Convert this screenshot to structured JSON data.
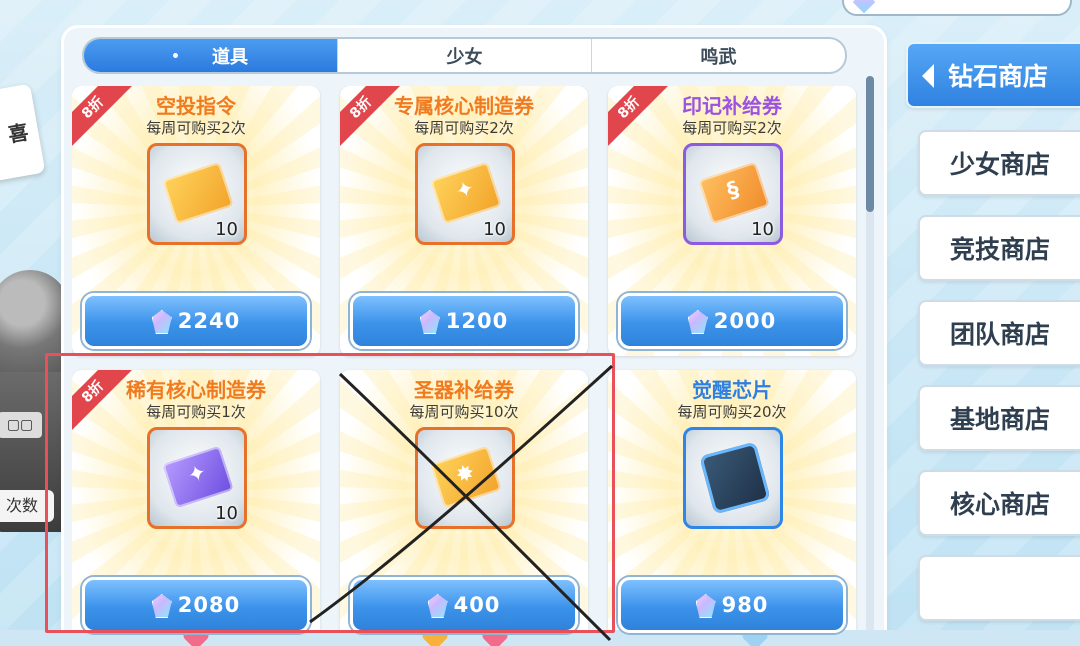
{
  "tabs": [
    {
      "label": "道具",
      "active": true
    },
    {
      "label": "少女",
      "active": false
    },
    {
      "label": "鸣武",
      "active": false
    }
  ],
  "left_overlay": {
    "badge_text": "喜",
    "times_label": "次数"
  },
  "items": [
    {
      "name": "空投指令",
      "limit": "每周可购买2次",
      "discount": "8折",
      "qty": "10",
      "price": "2240",
      "name_color": "#f07a1e"
    },
    {
      "name": "专属核心制造券",
      "limit": "每周可购买2次",
      "discount": "8折",
      "qty": "10",
      "price": "1200",
      "name_color": "#f07a1e"
    },
    {
      "name": "印记补给券",
      "limit": "每周可购买2次",
      "discount": "8折",
      "qty": "10",
      "price": "2000",
      "name_color": "#9a52e0"
    },
    {
      "name": "稀有核心制造券",
      "limit": "每周可购买1次",
      "discount": "8折",
      "qty": "10",
      "price": "2080",
      "name_color": "#f07a1e"
    },
    {
      "name": "圣器补给券",
      "limit": "每周可购买10次",
      "discount": "",
      "qty": "",
      "price": "400",
      "name_color": "#f07a1e"
    },
    {
      "name": "觉醒芯片",
      "limit": "每周可购买20次",
      "discount": "",
      "qty": "",
      "price": "980",
      "name_color": "#2d7fe0"
    }
  ],
  "sidebar": {
    "items": [
      {
        "label": "钻石商店",
        "active": true
      },
      {
        "label": "少女商店",
        "active": false
      },
      {
        "label": "竞技商店",
        "active": false
      },
      {
        "label": "团队商店",
        "active": false
      },
      {
        "label": "基地商店",
        "active": false
      },
      {
        "label": "核心商店",
        "active": false
      }
    ]
  },
  "colors": {
    "accent_blue": "#2f82e0",
    "discount_red": "#e2464d",
    "annotation_red": "#e8505a"
  }
}
